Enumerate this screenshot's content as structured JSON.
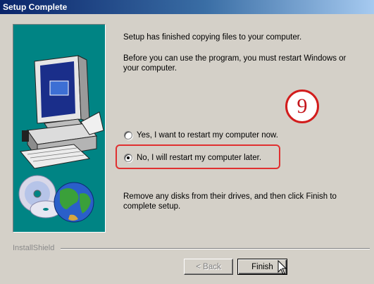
{
  "window": {
    "title": "Setup Complete"
  },
  "content": {
    "message_1": "Setup has finished copying files to your computer.",
    "message_2": "Before you can use the program, you must restart Windows or your computer.",
    "message_3": "Remove any disks from their drives, and then click Finish to complete setup."
  },
  "options": [
    {
      "label": "Yes, I want to restart my computer now.",
      "selected": false
    },
    {
      "label": "No, I will restart my computer later.",
      "selected": true
    }
  ],
  "annotation": {
    "step_number": "9",
    "color": "#d21d1d"
  },
  "footer": {
    "brand": "InstallShield"
  },
  "buttons": {
    "back": "< Back",
    "finish": "Finish",
    "back_enabled": false
  },
  "colors": {
    "title_bar": "#0a246a",
    "panel": "#d4d0c8",
    "art_background": "#008484"
  },
  "icons": {
    "artwork": "computer-and-cds-illustration",
    "cursor": "mouse-pointer-icon"
  }
}
